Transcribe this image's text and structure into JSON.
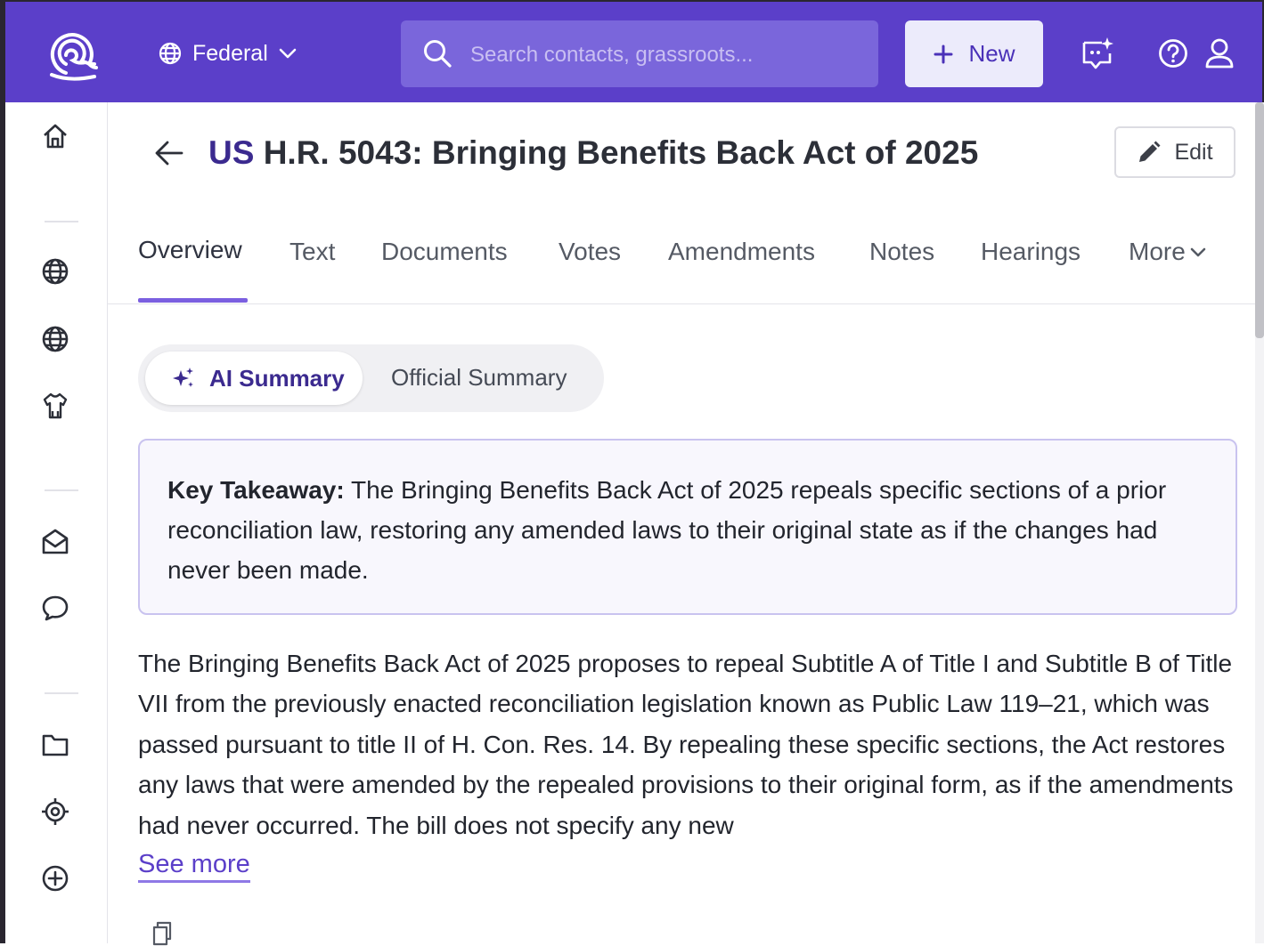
{
  "header": {
    "scope_label": "Federal",
    "search_placeholder": "Search contacts, grassroots...",
    "new_button_label": "New"
  },
  "page": {
    "title_prefix": "US",
    "title": "H.R. 5043: Bringing Benefits Back Act of 2025",
    "edit_label": "Edit"
  },
  "tabs": [
    {
      "label": "Overview",
      "active": true
    },
    {
      "label": "Text"
    },
    {
      "label": "Documents"
    },
    {
      "label": "Votes"
    },
    {
      "label": "Amendments"
    },
    {
      "label": "Notes"
    },
    {
      "label": "Hearings"
    },
    {
      "label": "More"
    }
  ],
  "summary_toggle": {
    "ai_label": "AI Summary",
    "official_label": "Official Summary"
  },
  "takeaway": {
    "label": "Key Takeaway:",
    "text": " The Bringing Benefits Back Act of 2025 repeals specific sections of a prior reconciliation law, restoring any amended laws to their original state as if the changes had never been made."
  },
  "summary_text": "The Bringing Benefits Back Act of 2025 proposes to repeal Subtitle A of Title I and Subtitle B of Title VII from the previously enacted reconciliation legislation known as Public Law 119–21, which was passed pursuant to title II of H. Con. Res. 14. By repealing these specific sections, the Act restores any laws that were amended by the repealed provisions to their original form, as if the amendments had never occurred. The bill does not specify any new",
  "see_more_label": "See more",
  "colors": {
    "brand": "#5b3fc9",
    "accent_dark": "#3b2a8f"
  },
  "icons": [
    "app-logo-icon",
    "globe-icon",
    "chevron-down-icon",
    "search-icon",
    "plus-icon",
    "ai-chat-icon",
    "help-icon",
    "user-icon",
    "home-icon",
    "globe-icon",
    "globe-icon",
    "shirt-icon",
    "mail-open-icon",
    "chat-bubble-icon",
    "folder-icon",
    "target-icon",
    "plus-circle-icon",
    "arrow-left-icon",
    "pencil-icon",
    "sparkle-icon",
    "copy-icon"
  ]
}
